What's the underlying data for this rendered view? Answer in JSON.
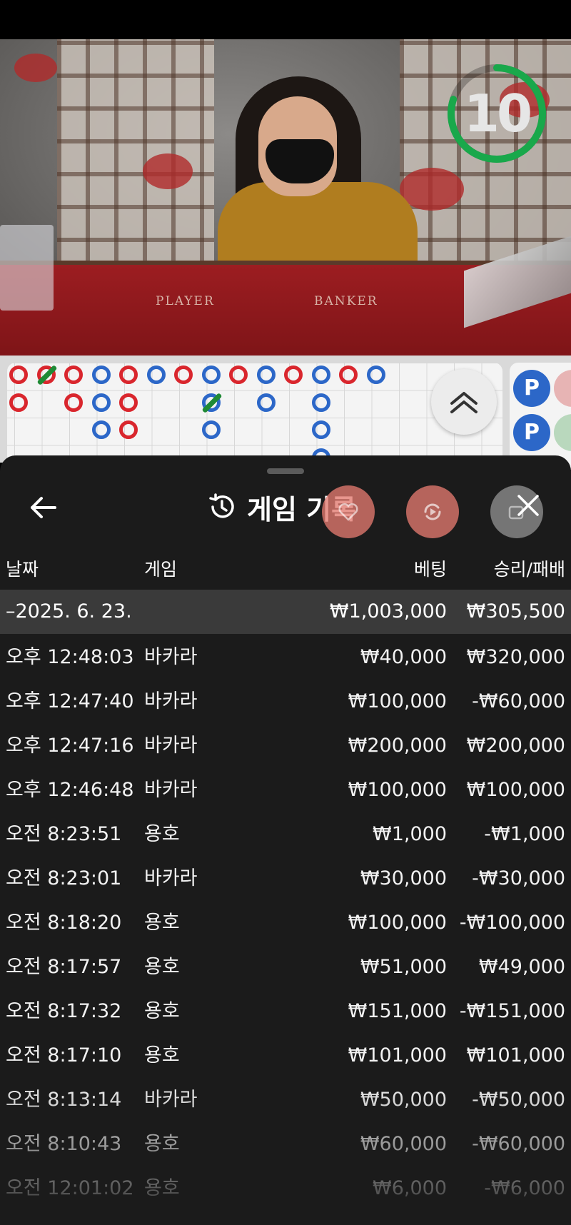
{
  "video": {
    "countdown": "10",
    "countdown_progress": 0.8,
    "table_labels": {
      "player": "PLAYER",
      "banker": "BANKER"
    }
  },
  "side_road": {
    "chips": [
      "P",
      "P"
    ]
  },
  "history": {
    "title": "게임 기록",
    "columns": {
      "date": "날짜",
      "game": "게임",
      "bet": "베팅",
      "win_loss": "승리/패배"
    },
    "date_group": {
      "label": "–2025. 6. 23.",
      "total_bet": "₩1,003,000",
      "total_win_loss": "₩305,500"
    },
    "rows": [
      {
        "time": "오후 12:48:03",
        "game": "바카라",
        "bet": "₩40,000",
        "win_loss": "₩320,000"
      },
      {
        "time": "오후 12:47:40",
        "game": "바카라",
        "bet": "₩100,000",
        "win_loss": "-₩60,000"
      },
      {
        "time": "오후 12:47:16",
        "game": "바카라",
        "bet": "₩200,000",
        "win_loss": "₩200,000"
      },
      {
        "time": "오후 12:46:48",
        "game": "바카라",
        "bet": "₩100,000",
        "win_loss": "₩100,000"
      },
      {
        "time": "오전 8:23:51",
        "game": "용호",
        "bet": "₩1,000",
        "win_loss": "-₩1,000"
      },
      {
        "time": "오전 8:23:01",
        "game": "바카라",
        "bet": "₩30,000",
        "win_loss": "-₩30,000"
      },
      {
        "time": "오전 8:18:20",
        "game": "용호",
        "bet": "₩100,000",
        "win_loss": "-₩100,000"
      },
      {
        "time": "오전 8:17:57",
        "game": "용호",
        "bet": "₩51,000",
        "win_loss": "₩49,000"
      },
      {
        "time": "오전 8:17:32",
        "game": "용호",
        "bet": "₩151,000",
        "win_loss": "-₩151,000"
      },
      {
        "time": "오전 8:17:10",
        "game": "용호",
        "bet": "₩101,000",
        "win_loss": "₩101,000"
      },
      {
        "time": "오전 8:13:14",
        "game": "바카라",
        "bet": "₩50,000",
        "win_loss": "-₩50,000"
      },
      {
        "time": "오전 8:10:43",
        "game": "용호",
        "bet": "₩60,000",
        "win_loss": "-₩60,000"
      },
      {
        "time": "오전 12:01:02",
        "game": "용호",
        "bet": "₩6,000",
        "win_loss": "-₩6,000"
      }
    ]
  },
  "icons": [
    "back-arrow-icon",
    "history-clock-icon",
    "close-icon",
    "favorite-icon",
    "refresh-icon",
    "external-window-icon",
    "chevron-up-double-icon"
  ],
  "colors": {
    "banker_red": "#d9262d",
    "player_blue": "#2c67c8",
    "tie_green": "#1f8a35",
    "timer_green": "#19a84b",
    "sheet_bg": "#1b1b1b"
  }
}
